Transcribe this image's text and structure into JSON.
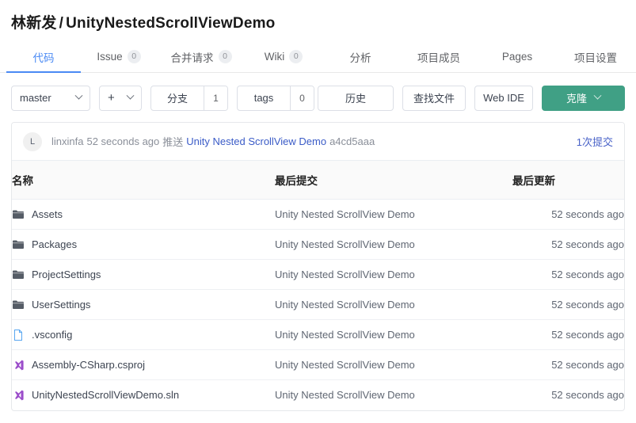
{
  "header": {
    "owner": "林新发",
    "separator": "/",
    "repo": "UnityNestedScrollViewDemo"
  },
  "tabs": [
    {
      "label": "代码",
      "badge": null,
      "active": true
    },
    {
      "label": "Issue",
      "badge": "0",
      "active": false
    },
    {
      "label": "合并请求",
      "badge": "0",
      "active": false
    },
    {
      "label": "Wiki",
      "badge": "0",
      "active": false
    },
    {
      "label": "分析",
      "badge": null,
      "active": false
    },
    {
      "label": "项目成员",
      "badge": null,
      "active": false
    },
    {
      "label": "Pages",
      "badge": null,
      "active": false
    },
    {
      "label": "项目设置",
      "badge": null,
      "active": false
    }
  ],
  "toolbar": {
    "branch_selected": "master",
    "add_label": "+",
    "branches_label": "分支",
    "branches_count": "1",
    "tags_label": "tags",
    "tags_count": "0",
    "history_label": "历史",
    "find_file_label": "查找文件",
    "web_ide_label": "Web IDE",
    "clone_label": "克隆"
  },
  "commit_bar": {
    "avatar_initial": "L",
    "author": "linxinfa",
    "relative_time": "52 seconds ago",
    "action": "推送",
    "message": "Unity Nested ScrollView Demo",
    "sha": "a4cd5aaa",
    "commit_count_label": "1次提交"
  },
  "table": {
    "columns": [
      "名称",
      "最后提交",
      "最后更新"
    ],
    "rows": [
      {
        "name": "Assets",
        "icon": "folder-icon",
        "commit": "Unity Nested ScrollView Demo",
        "updated": "52 seconds ago"
      },
      {
        "name": "Packages",
        "icon": "folder-icon",
        "commit": "Unity Nested ScrollView Demo",
        "updated": "52 seconds ago"
      },
      {
        "name": "ProjectSettings",
        "icon": "folder-icon",
        "commit": "Unity Nested ScrollView Demo",
        "updated": "52 seconds ago"
      },
      {
        "name": "UserSettings",
        "icon": "folder-icon",
        "commit": "Unity Nested ScrollView Demo",
        "updated": "52 seconds ago"
      },
      {
        "name": ".vsconfig",
        "icon": "file-icon",
        "commit": "Unity Nested ScrollView Demo",
        "updated": "52 seconds ago"
      },
      {
        "name": "Assembly-CSharp.csproj",
        "icon": "visual-studio-icon",
        "commit": "Unity Nested ScrollView Demo",
        "updated": "52 seconds ago"
      },
      {
        "name": "UnityNestedScrollViewDemo.sln",
        "icon": "visual-studio-icon",
        "commit": "Unity Nested ScrollView Demo",
        "updated": "52 seconds ago"
      }
    ]
  },
  "colors": {
    "accent_blue": "#4a8af4",
    "link_blue": "#3a5bc7",
    "clone_green": "#40a085",
    "folder_gray": "#555c66",
    "file_blue": "#58a6f0",
    "vs_purple": "#9b4dca"
  }
}
